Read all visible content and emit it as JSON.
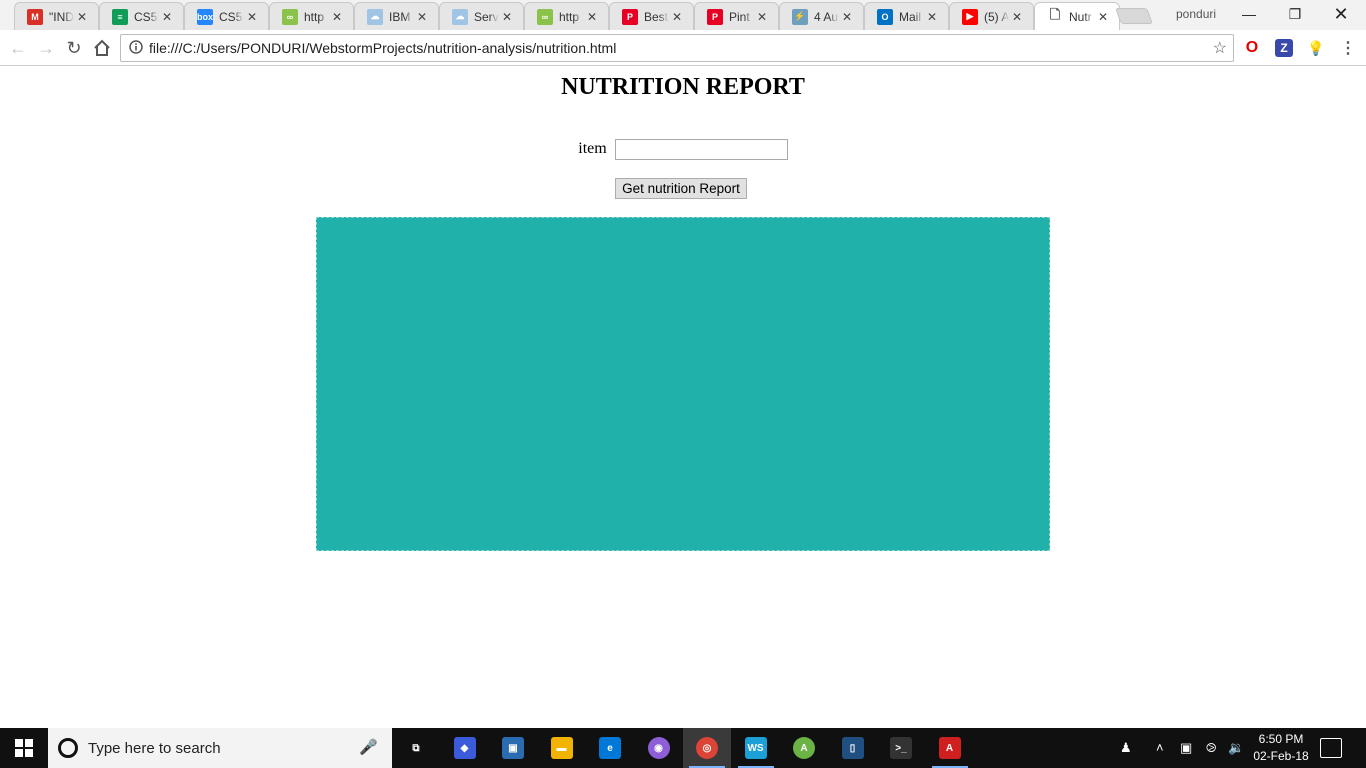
{
  "browser": {
    "tabs": [
      {
        "icon": "gmail-icon",
        "title": "\"IND",
        "color": "#d93025",
        "glyph": "M"
      },
      {
        "icon": "sheets-icon",
        "title": "CS5!",
        "color": "#0f9d58",
        "glyph": "≡"
      },
      {
        "icon": "box-icon",
        "title": "CS5!",
        "color": "#2486fc",
        "glyph": "box"
      },
      {
        "icon": "link-icon",
        "title": "http",
        "color": "#8bc34a",
        "glyph": "∞"
      },
      {
        "icon": "cloud-icon",
        "title": "IBM",
        "color": "#a0c4e4",
        "glyph": "☁"
      },
      {
        "icon": "cloud-icon",
        "title": "Serv",
        "color": "#a0c4e4",
        "glyph": "☁"
      },
      {
        "icon": "link-icon",
        "title": "http",
        "color": "#8bc34a",
        "glyph": "∞"
      },
      {
        "icon": "pinterest-icon",
        "title": "Best",
        "color": "#e60023",
        "glyph": "P"
      },
      {
        "icon": "pinterest-icon",
        "title": "Pint",
        "color": "#e60023",
        "glyph": "P"
      },
      {
        "icon": "bolt-icon",
        "title": "4 Au",
        "color": "#6e9fbf",
        "glyph": "⚡"
      },
      {
        "icon": "outlook-icon",
        "title": "Mail",
        "color": "#0072c6",
        "glyph": "O"
      },
      {
        "icon": "youtube-icon",
        "title": "(5) A",
        "color": "#ff0000",
        "glyph": "▶"
      },
      {
        "icon": "page-icon",
        "title": "Nutr",
        "color": "#ffffff",
        "glyph": "🗋",
        "active": true
      }
    ],
    "profile": "ponduri",
    "url": "file:///C:/Users/PONDURI/WebstormProjects/nutrition-analysis/nutrition.html"
  },
  "page": {
    "title": "NUTRITION REPORT",
    "item_label": "item",
    "item_value": "",
    "button_label": "Get nutrition Report",
    "panel_color": "#20b2aa"
  },
  "taskbar": {
    "search_placeholder": "Type here to search",
    "apps": [
      {
        "icon": "task-view-icon",
        "color": "#101010",
        "glyph": "⧉"
      },
      {
        "icon": "app-icon",
        "color": "#3b5bdb",
        "glyph": "◆"
      },
      {
        "icon": "remote-desktop-icon",
        "color": "#2b6cb0",
        "glyph": "▣"
      },
      {
        "icon": "file-explorer-icon",
        "color": "#f2b400",
        "glyph": "▬"
      },
      {
        "icon": "edge-icon",
        "color": "#0078d7",
        "glyph": "e"
      },
      {
        "icon": "github-desktop-icon",
        "color": "#8e5ed8",
        "glyph": "◉"
      },
      {
        "icon": "chrome-icon",
        "color": "#db4437",
        "glyph": "◎",
        "active": true
      },
      {
        "icon": "webstorm-icon",
        "color": "#1ba0d8",
        "glyph": "WS",
        "running": true
      },
      {
        "icon": "android-studio-icon",
        "color": "#6ab344",
        "glyph": "A"
      },
      {
        "icon": "sourcetree-icon",
        "color": "#205081",
        "glyph": "▯"
      },
      {
        "icon": "terminal-icon",
        "color": "#333333",
        "glyph": ">_"
      },
      {
        "icon": "acrobat-icon",
        "color": "#d01f1f",
        "glyph": "A",
        "running": true
      }
    ],
    "time": "6:50 PM",
    "date": "02-Feb-18"
  }
}
